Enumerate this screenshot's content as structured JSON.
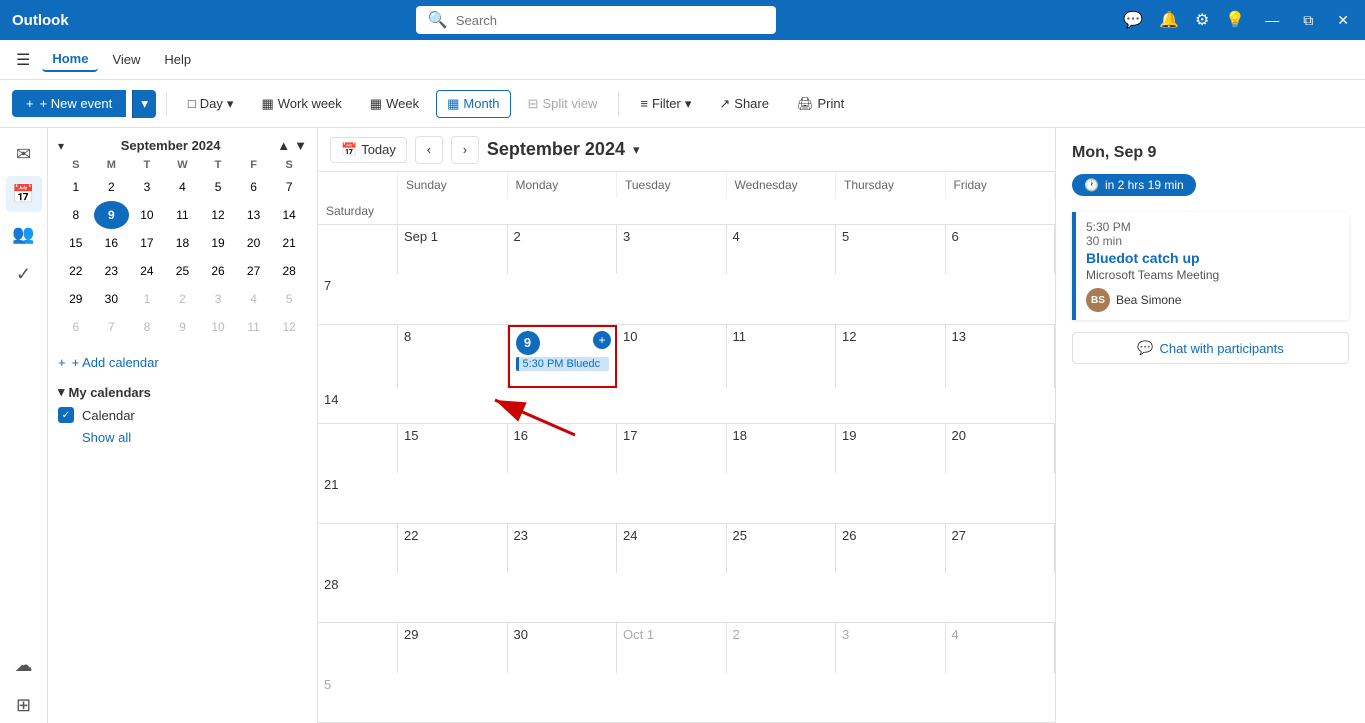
{
  "titlebar": {
    "logo": "Outlook",
    "search_placeholder": "Search",
    "icons": [
      "feedback-icon",
      "bell-icon",
      "settings-icon",
      "lightbulb-icon"
    ],
    "window_controls": [
      "minimize",
      "restore",
      "close"
    ]
  },
  "menubar": {
    "hamburger": "☰",
    "items": [
      "Home",
      "View",
      "Help"
    ],
    "active": "Home"
  },
  "toolbar": {
    "new_event_label": "+ New event",
    "dropdown_arrow": "▾",
    "buttons": [
      {
        "label": "Day",
        "icon": "□",
        "active": false
      },
      {
        "label": "Work week",
        "icon": "▦",
        "active": false
      },
      {
        "label": "Week",
        "icon": "▦",
        "active": false
      },
      {
        "label": "Month",
        "icon": "▦",
        "active": true
      },
      {
        "label": "Split view",
        "icon": "⊟",
        "active": false
      }
    ],
    "filter_label": "Filter",
    "share_label": "Share",
    "print_label": "Print"
  },
  "mini_calendar": {
    "month_year": "September 2024",
    "days_header": [
      "S",
      "M",
      "T",
      "W",
      "T",
      "F",
      "S"
    ],
    "weeks": [
      [
        {
          "num": "",
          "other": true
        },
        {
          "num": "",
          "other": true
        },
        {
          "num": "",
          "other": true
        },
        {
          "num": "",
          "other": true
        },
        {
          "num": "",
          "other": true
        },
        {
          "num": "",
          "other": true
        },
        {
          "num": "",
          "other": true
        }
      ],
      [
        {
          "num": "1"
        },
        {
          "num": "2"
        },
        {
          "num": "3"
        },
        {
          "num": "4"
        },
        {
          "num": "5"
        },
        {
          "num": "6"
        },
        {
          "num": "7"
        }
      ],
      [
        {
          "num": "8"
        },
        {
          "num": "9",
          "today": true
        },
        {
          "num": "10"
        },
        {
          "num": "11"
        },
        {
          "num": "12"
        },
        {
          "num": "13"
        },
        {
          "num": "14"
        }
      ],
      [
        {
          "num": "15"
        },
        {
          "num": "16"
        },
        {
          "num": "17"
        },
        {
          "num": "18"
        },
        {
          "num": "19"
        },
        {
          "num": "20"
        },
        {
          "num": "21"
        }
      ],
      [
        {
          "num": "22"
        },
        {
          "num": "23"
        },
        {
          "num": "24"
        },
        {
          "num": "25"
        },
        {
          "num": "26"
        },
        {
          "num": "27"
        },
        {
          "num": "28"
        }
      ],
      [
        {
          "num": "29"
        },
        {
          "num": "30"
        },
        {
          "num": "1",
          "other": true
        },
        {
          "num": "2",
          "other": true
        },
        {
          "num": "3",
          "other": true
        },
        {
          "num": "4",
          "other": true
        },
        {
          "num": "5",
          "other": true
        }
      ],
      [
        {
          "num": "6",
          "other": true
        },
        {
          "num": "7",
          "other": true
        },
        {
          "num": "8",
          "other": true
        },
        {
          "num": "9",
          "other": true
        },
        {
          "num": "10",
          "other": true
        },
        {
          "num": "11",
          "other": true
        },
        {
          "num": "12",
          "other": true
        }
      ]
    ]
  },
  "sidebar": {
    "add_calendar_label": "+ Add calendar",
    "my_calendars_label": "My calendars",
    "calendar_label": "Calendar",
    "show_all_label": "Show all"
  },
  "icon_nav": {
    "items": [
      {
        "icon": "✉",
        "name": "mail",
        "active": false
      },
      {
        "icon": "📅",
        "name": "calendar",
        "active": true
      },
      {
        "icon": "👥",
        "name": "people",
        "active": false
      },
      {
        "icon": "✓",
        "name": "tasks",
        "active": false
      },
      {
        "icon": "☁",
        "name": "onedrive",
        "active": false
      },
      {
        "icon": "⊞",
        "name": "apps",
        "active": false
      }
    ]
  },
  "main_calendar": {
    "today_button": "Today",
    "title": "September 2024",
    "day_labels": [
      "Sunday",
      "Monday",
      "Tuesday",
      "Wednesday",
      "Thursday",
      "Friday",
      "Saturday"
    ],
    "weeks": [
      {
        "cells": [
          {
            "date": "Sep 1",
            "other": false
          },
          {
            "date": "2",
            "other": false
          },
          {
            "date": "3",
            "other": false
          },
          {
            "date": "4",
            "other": false
          },
          {
            "date": "5",
            "other": false
          },
          {
            "date": "6",
            "other": false
          },
          {
            "date": "7",
            "other": false
          }
        ]
      },
      {
        "cells": [
          {
            "date": "8",
            "other": false
          },
          {
            "date": "9",
            "other": false,
            "today": true,
            "selected": true,
            "event": {
              "time": "5:30 PM",
              "name": "Bluedc"
            }
          },
          {
            "date": "10",
            "other": false
          },
          {
            "date": "11",
            "other": false
          },
          {
            "date": "12",
            "other": false
          },
          {
            "date": "13",
            "other": false
          },
          {
            "date": "14",
            "other": false
          }
        ]
      },
      {
        "cells": [
          {
            "date": "15",
            "other": false
          },
          {
            "date": "16",
            "other": false
          },
          {
            "date": "17",
            "other": false
          },
          {
            "date": "18",
            "other": false
          },
          {
            "date": "19",
            "other": false
          },
          {
            "date": "20",
            "other": false
          },
          {
            "date": "21",
            "other": false
          }
        ]
      },
      {
        "cells": [
          {
            "date": "22",
            "other": false
          },
          {
            "date": "23",
            "other": false
          },
          {
            "date": "24",
            "other": false
          },
          {
            "date": "25",
            "other": false
          },
          {
            "date": "26",
            "other": false
          },
          {
            "date": "27",
            "other": false
          },
          {
            "date": "28",
            "other": false
          }
        ]
      },
      {
        "cells": [
          {
            "date": "29",
            "other": false
          },
          {
            "date": "30",
            "other": false
          },
          {
            "date": "Oct 1",
            "other": true
          },
          {
            "date": "2",
            "other": true
          },
          {
            "date": "3",
            "other": true
          },
          {
            "date": "4",
            "other": true
          },
          {
            "date": "5",
            "other": true
          }
        ]
      }
    ]
  },
  "right_panel": {
    "date": "Mon, Sep 9",
    "time_badge": "in 2 hrs 19 min",
    "event": {
      "time": "5:30 PM",
      "duration": "30 min",
      "name": "Bluedot catch up",
      "subtitle": "Microsoft Teams Meeting",
      "attendee_initials": "BS",
      "attendee_name": "Bea Simone"
    },
    "chat_button_label": "Chat with participants"
  },
  "colors": {
    "accent": "#0f6cbd",
    "today_bg": "#0f6cbd",
    "selected_border": "#cc0000",
    "event_bg": "#cce4f7",
    "event_border": "#0f6cbd"
  }
}
